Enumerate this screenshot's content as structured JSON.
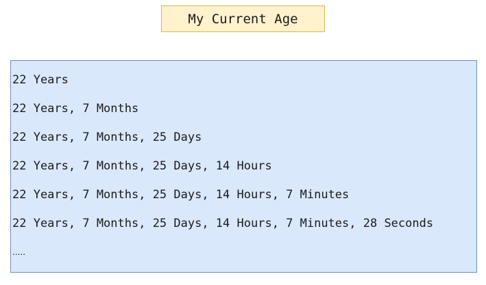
{
  "title": "My Current Age",
  "lines": [
    "22 Years",
    "22 Years, 7 Months",
    "22 Years, 7 Months, 25 Days",
    "22 Years, 7 Months, 25 Days, 14 Hours",
    "22 Years, 7 Months, 25 Days, 14 Hours, 7 Minutes",
    "22 Years, 7 Months, 25 Days, 14 Hours, 7 Minutes, 28 Seconds"
  ],
  "ellipsis": ".....",
  "colors": {
    "title_fill": "#fff2cc",
    "title_border": "#d6b656",
    "panel_fill": "#dae8fc",
    "panel_border": "#6c8ebf"
  }
}
